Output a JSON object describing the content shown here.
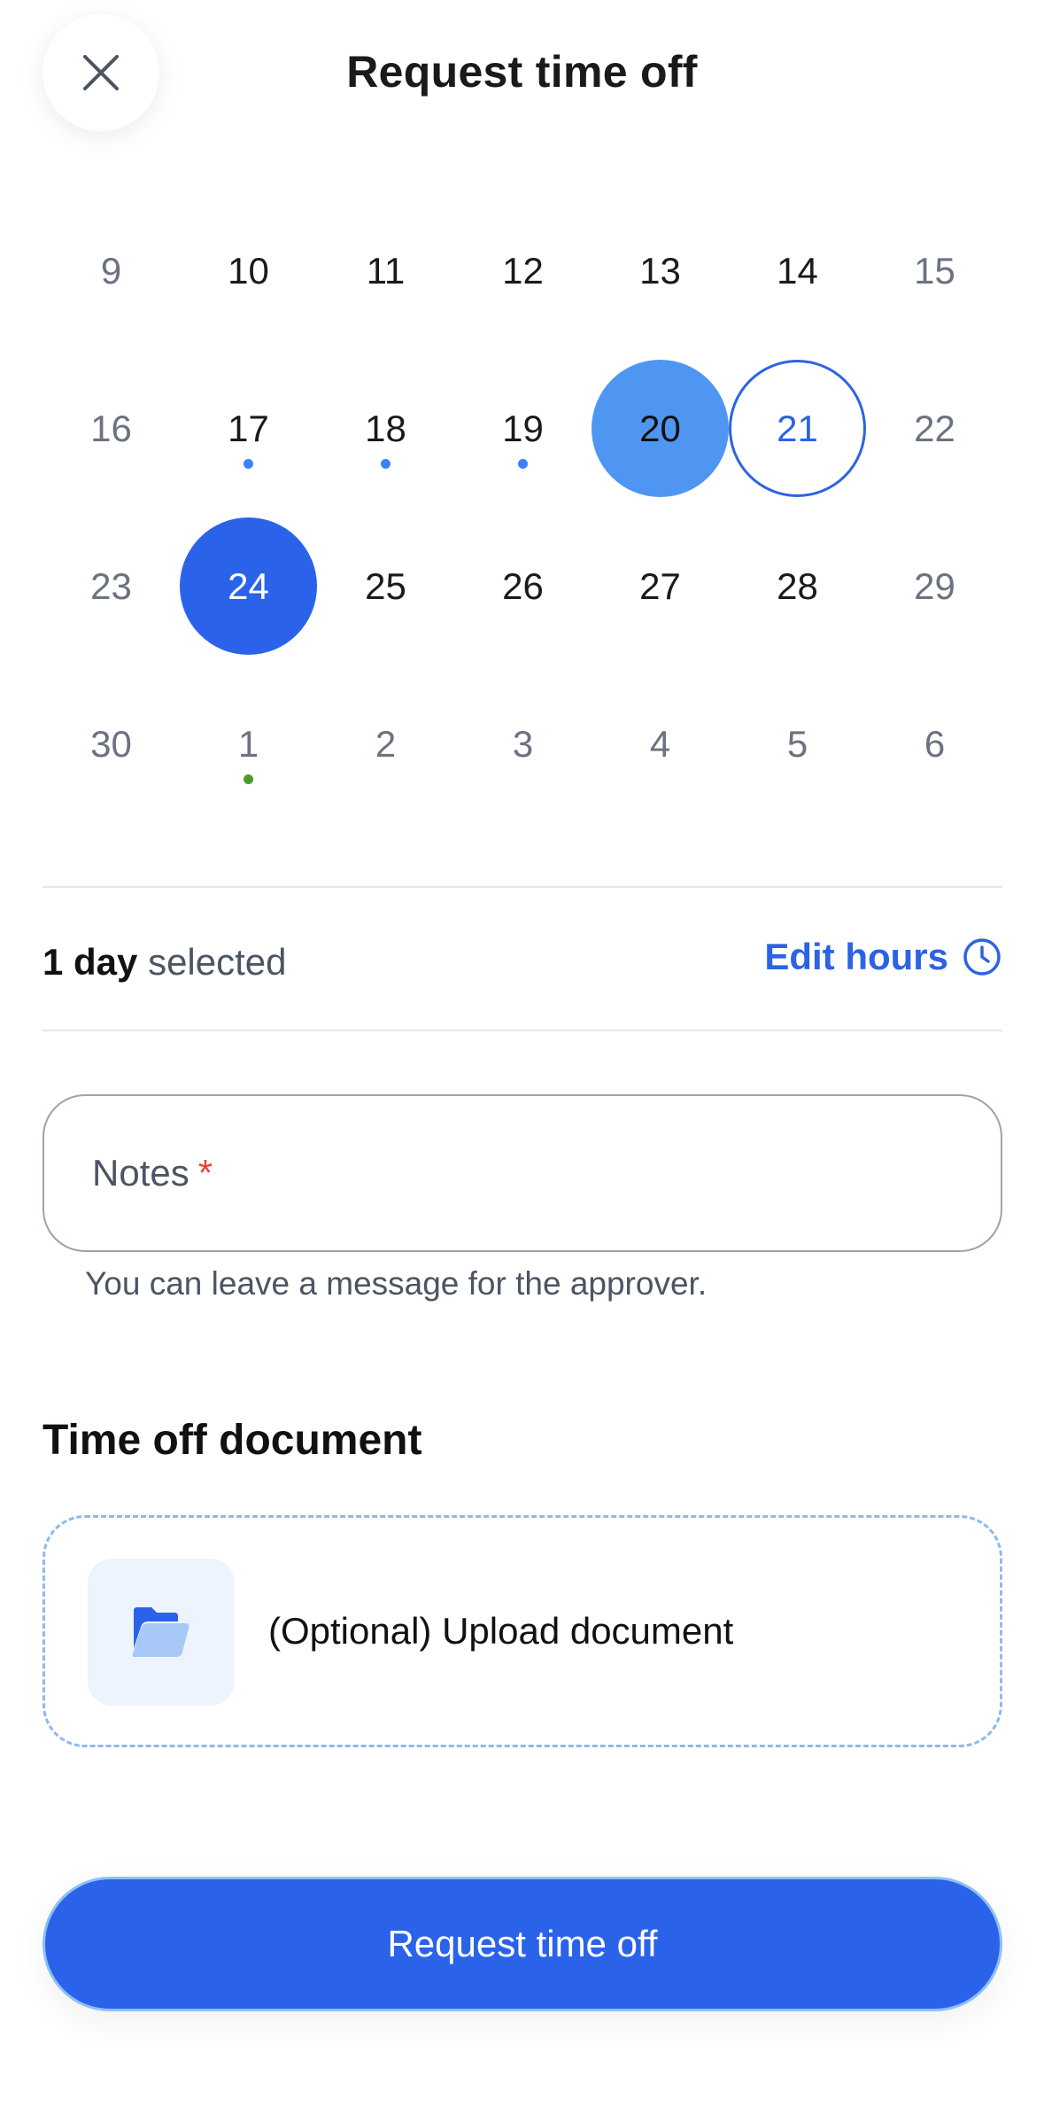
{
  "header": {
    "title": "Request time off",
    "close_icon": "close-icon"
  },
  "calendar": {
    "rows": [
      [
        "9",
        "10",
        "11",
        "12",
        "13",
        "14",
        "15"
      ],
      [
        "16",
        "17",
        "18",
        "19",
        "20",
        "21",
        "22"
      ],
      [
        "23",
        "24",
        "25",
        "26",
        "27",
        "28",
        "29"
      ],
      [
        "30",
        "1",
        "2",
        "3",
        "4",
        "5",
        "6"
      ]
    ],
    "muted_days": [
      [
        0,
        0
      ],
      [
        0,
        6
      ],
      [
        1,
        0
      ],
      [
        1,
        6
      ],
      [
        2,
        0
      ],
      [
        2,
        6
      ],
      [
        3,
        0
      ],
      [
        3,
        1
      ],
      [
        3,
        2
      ],
      [
        3,
        3
      ],
      [
        3,
        4
      ],
      [
        3,
        5
      ],
      [
        3,
        6
      ]
    ],
    "highlight_light": [
      1,
      4
    ],
    "highlight_outline": [
      1,
      5
    ],
    "highlight_strong": [
      2,
      1
    ],
    "blue_dot_days": [
      [
        1,
        1
      ],
      [
        1,
        2
      ],
      [
        1,
        3
      ]
    ],
    "green_dot_days": [
      [
        3,
        1
      ]
    ],
    "colors": {
      "blue_dot": "#3b82f6",
      "green_dot": "#4c9a2a",
      "accent": "#2a63ea",
      "light_selection": "#4f96f3"
    }
  },
  "summary": {
    "count_text": "1 day",
    "suffix_text": "selected",
    "edit_label": "Edit hours",
    "edit_icon": "clock-icon"
  },
  "notes": {
    "label": "Notes",
    "required_mark": "*",
    "helper": "You can leave a message for the approver."
  },
  "document": {
    "section_title": "Time off document",
    "upload_label": "(Optional) Upload document",
    "icon": "folder-icon"
  },
  "footer": {
    "button_label": "Request time off"
  }
}
